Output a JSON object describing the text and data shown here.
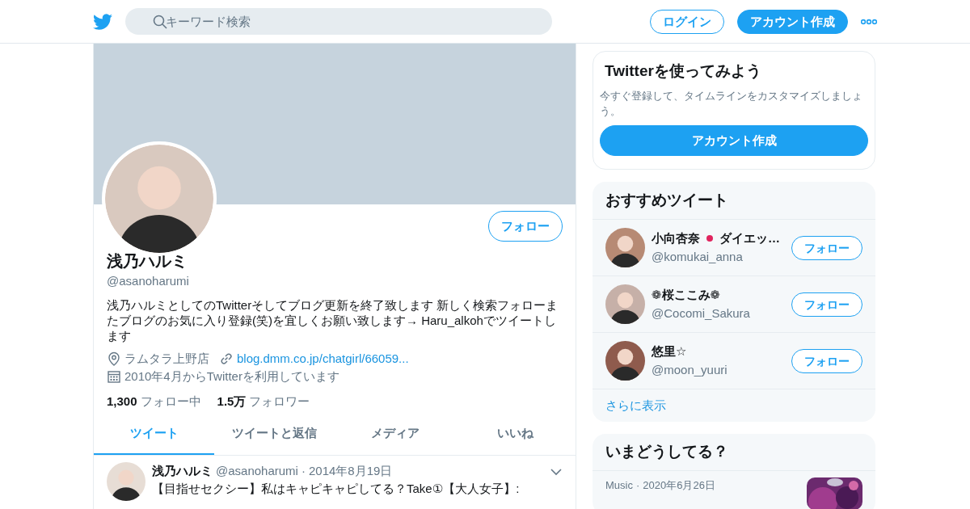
{
  "header": {
    "search": {
      "placeholder": "キーワード検索"
    },
    "login": "ログイン",
    "signup": "アカウント作成"
  },
  "profile": {
    "name": "浅乃ハルミ",
    "handle": "@asanoharumi",
    "follow": "フォロー",
    "bio": "浅乃ハルミとしてのTwitterそしてブログ更新を終了致します 新しく検索フォローまたブログのお気に入り登録(笑)を宜しくお願い致します→ Haru_alkohでツイートします",
    "location": "ラムタラ上野店",
    "website": "blog.dmm.co.jp/chatgirl/66059...",
    "joined": "2010年4月からTwitterを利用しています",
    "stats": [
      {
        "count": "1,300",
        "label": "フォロー中"
      },
      {
        "count": "1.5万",
        "label": "フォロワー"
      }
    ]
  },
  "tabs": [
    {
      "label": "ツイート",
      "selected": true
    },
    {
      "label": "ツイートと返信",
      "selected": false
    },
    {
      "label": "メディア",
      "selected": false
    },
    {
      "label": "いいね",
      "selected": false
    }
  ],
  "tweets": [
    {
      "name": "浅乃ハルミ",
      "handle": "@asanoharumi",
      "separator": "·",
      "date": "2014年8月19日",
      "text": "【目指せセクシー】私はキャピキャピしてる？Take①【大人女子】:"
    }
  ],
  "signup_card": {
    "title": "Twitterを使ってみよう",
    "text": "今すぐ登録して、タイムラインをカスタマイズしましょう。",
    "button": "アカウント作成"
  },
  "recommended": {
    "title": "おすすめツイート",
    "users": [
      {
        "name": "小向杏奈",
        "color": "#e0245e",
        "name_suffix": "ダイエッ…",
        "handle": "@komukai_anna",
        "button": "フォロー"
      },
      {
        "name": "❁桜ここみ❁",
        "handle": "@Cocomi_Sakura",
        "button": "フォロー"
      },
      {
        "name": "悠里☆",
        "handle": "@moon_yuuri",
        "button": "フォロー"
      }
    ],
    "more": "さらに表示"
  },
  "trends": {
    "title": "いまどうしてる？",
    "items": [
      {
        "category": "Music",
        "separator": "·",
        "date": "2020年6月26日"
      }
    ]
  }
}
